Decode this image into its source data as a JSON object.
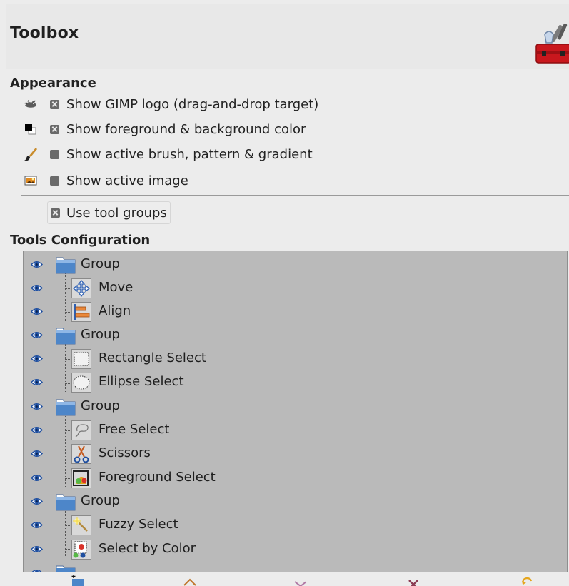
{
  "header": {
    "title": "Toolbox",
    "logo_icon": "toolbox-red-icon"
  },
  "appearance": {
    "title": "Appearance",
    "options": [
      {
        "icon": "gimp-wilber-icon",
        "checked": true,
        "label": "Show GIMP logo (drag-and-drop target)"
      },
      {
        "icon": "fg-bg-color-icon",
        "checked": true,
        "label": "Show foreground & background color"
      },
      {
        "icon": "brush-icon",
        "checked": false,
        "label": "Show active brush, pattern & gradient"
      },
      {
        "icon": "image-icon",
        "checked": false,
        "label": "Show active image"
      }
    ],
    "tool_groups": {
      "checked": true,
      "label": "Use tool groups"
    }
  },
  "tools_config": {
    "title": "Tools Configuration",
    "rows": [
      {
        "type": "group",
        "label": "Group",
        "icon": "folder-icon",
        "visible": true
      },
      {
        "type": "tool",
        "label": "Move",
        "icon": "move-tool-icon",
        "visible": true
      },
      {
        "type": "tool",
        "label": "Align",
        "icon": "align-tool-icon",
        "visible": true
      },
      {
        "type": "group",
        "label": "Group",
        "icon": "folder-icon",
        "visible": true
      },
      {
        "type": "tool",
        "label": "Rectangle Select",
        "icon": "rect-select-icon",
        "visible": true
      },
      {
        "type": "tool",
        "label": "Ellipse Select",
        "icon": "ellipse-select-icon",
        "visible": true
      },
      {
        "type": "group",
        "label": "Group",
        "icon": "folder-icon",
        "visible": true
      },
      {
        "type": "tool",
        "label": "Free Select",
        "icon": "free-select-icon",
        "visible": true
      },
      {
        "type": "tool",
        "label": "Scissors",
        "icon": "scissors-icon",
        "visible": true
      },
      {
        "type": "tool",
        "label": "Foreground Select",
        "icon": "foreground-select-icon",
        "visible": true
      },
      {
        "type": "group",
        "label": "Group",
        "icon": "folder-icon",
        "visible": true
      },
      {
        "type": "tool",
        "label": "Fuzzy Select",
        "icon": "fuzzy-select-icon",
        "visible": true
      },
      {
        "type": "tool",
        "label": "Select by Color",
        "icon": "select-by-color-icon",
        "visible": true
      }
    ]
  },
  "bottom_bar": {
    "buttons": [
      "new-group-icon",
      "raise-icon",
      "lower-icon",
      "delete-icon",
      "reset-icon"
    ]
  },
  "colors": {
    "tree_bg": "#bababa",
    "eye_blue": "#1f4fa0",
    "folder_blue": "#4d86c9",
    "toolbox_red": "#c9171d"
  }
}
